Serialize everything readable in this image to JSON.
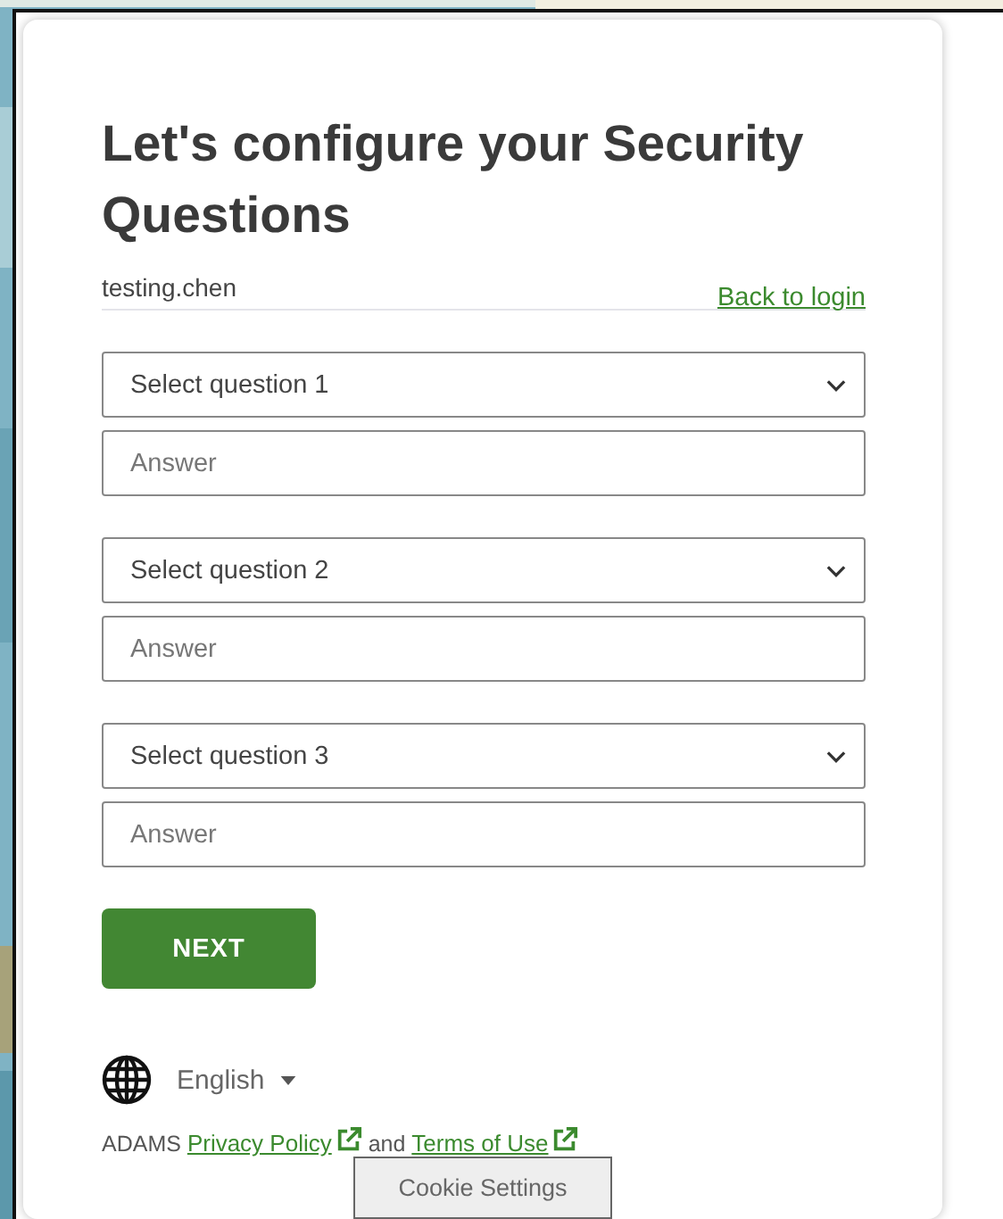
{
  "heading": "Let's configure your Security Questions",
  "username": "testing.chen",
  "back_link": "Back to login",
  "questions": [
    {
      "select": "Select question 1",
      "answer_placeholder": "Answer"
    },
    {
      "select": "Select question 2",
      "answer_placeholder": "Answer"
    },
    {
      "select": "Select question 3",
      "answer_placeholder": "Answer"
    }
  ],
  "next_button": "NEXT",
  "language": "English",
  "footer": {
    "prefix": "ADAMS",
    "privacy_link": "Privacy Policy",
    "conjunction": "and",
    "terms_link": "Terms of Use"
  },
  "cookie_button": "Cookie Settings"
}
